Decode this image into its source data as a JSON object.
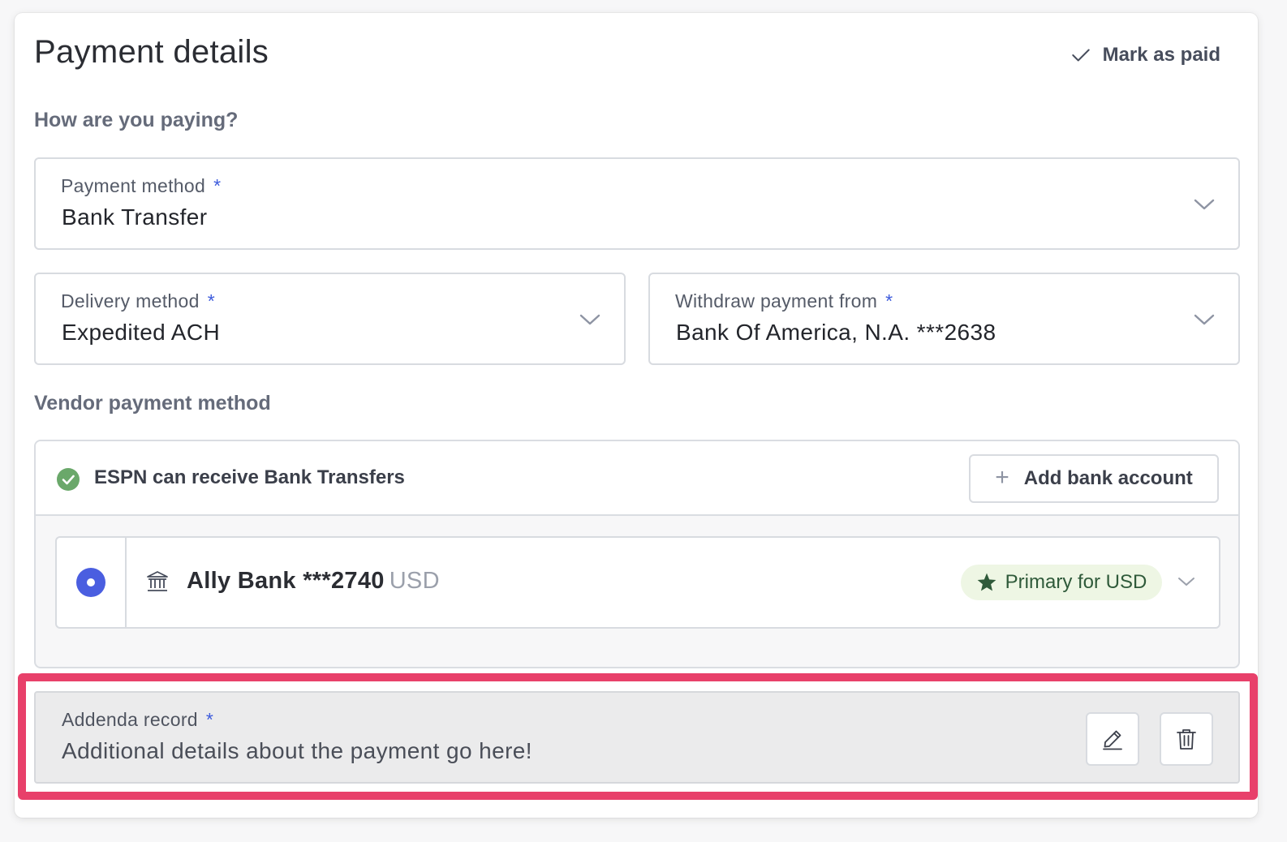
{
  "header": {
    "title": "Payment details",
    "mark_paid_label": "Mark as paid"
  },
  "how_paying": {
    "section_label": "How are you paying?",
    "payment_method": {
      "label": "Payment method",
      "required_mark": "*",
      "value": "Bank Transfer"
    },
    "delivery_method": {
      "label": "Delivery method",
      "required_mark": "*",
      "value": "Expedited ACH"
    },
    "withdraw_from": {
      "label": "Withdraw payment from",
      "required_mark": "*",
      "value": "Bank Of America, N.A. ***2638"
    }
  },
  "vendor": {
    "section_label": "Vendor payment method",
    "status_text": "ESPN can receive Bank Transfers",
    "add_bank_label": "Add bank account",
    "add_bank_icon": "+",
    "account": {
      "name": "Ally Bank ***2740",
      "currency": "USD",
      "badge": "Primary for USD",
      "selected": true
    }
  },
  "addenda": {
    "label": "Addenda record",
    "required_mark": "*",
    "value": "Additional details about the payment go here!"
  },
  "colors": {
    "accent": "#4a5ee0",
    "required": "#3d5bdc",
    "success": "#6aa86a",
    "badge_bg": "#eef6e4",
    "badge_star": "#2f5a3a",
    "highlight": "#e8406a"
  },
  "icons": {
    "mark_paid": "check-icon",
    "status": "check-circle-icon",
    "bank": "bank-icon",
    "badge": "star-icon",
    "edit": "pencil-icon",
    "delete": "trash-icon",
    "dropdown": "chevron-down-icon"
  }
}
